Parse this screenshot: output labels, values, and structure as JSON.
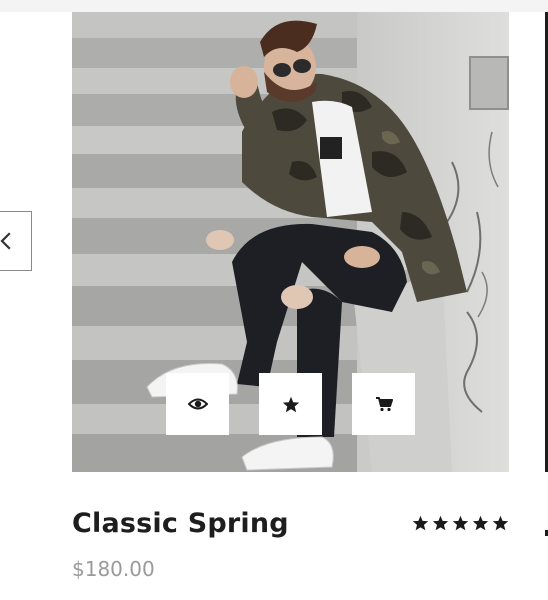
{
  "product": {
    "title": "Classic Spring",
    "price": "$180.00",
    "rating": 5,
    "rating_max": 5
  },
  "image": {
    "icon": "product-photo-man-on-stairs"
  },
  "carousel": {
    "prev_icon": "chevron-left-icon"
  },
  "actions": [
    {
      "name": "quick-view",
      "icon": "eye-icon"
    },
    {
      "name": "wishlist",
      "icon": "star-icon"
    },
    {
      "name": "add-to-cart",
      "icon": "cart-icon"
    }
  ],
  "colors": {
    "title": "#1e1e1e",
    "price": "#9a9a9a",
    "icon": "#1a1a1a"
  }
}
